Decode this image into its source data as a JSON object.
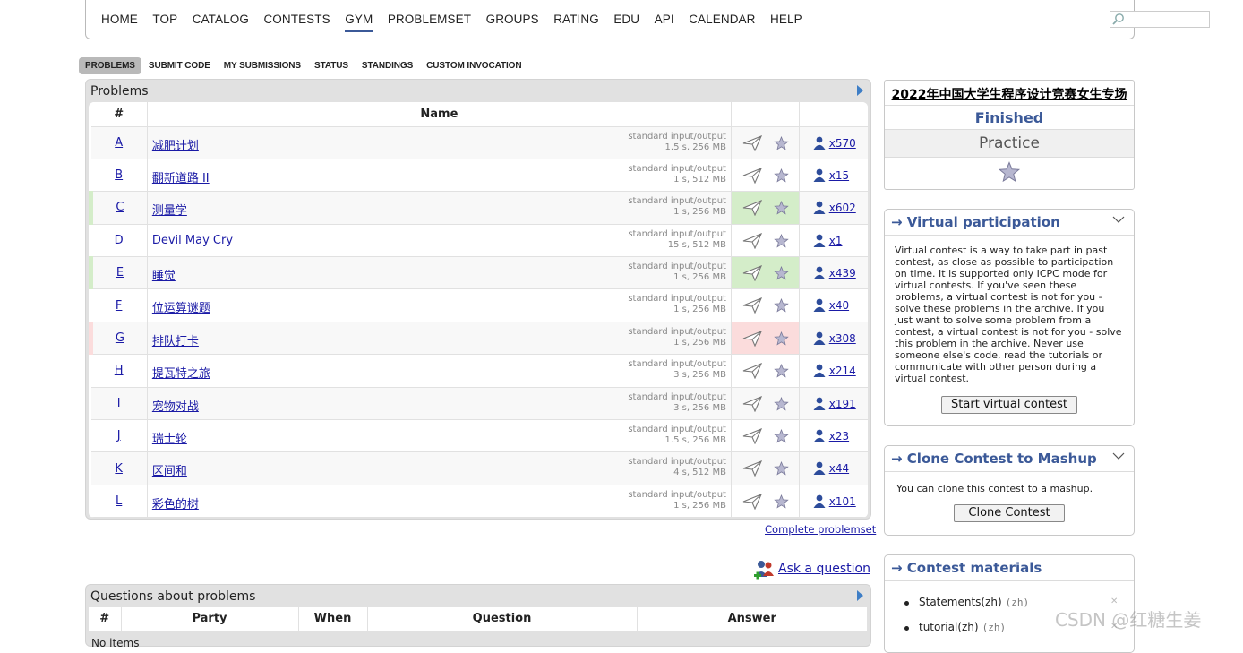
{
  "topnav": {
    "items": [
      "HOME",
      "TOP",
      "CATALOG",
      "CONTESTS",
      "GYM",
      "PROBLEMSET",
      "GROUPS",
      "RATING",
      "EDU",
      "API",
      "CALENDAR",
      "HELP"
    ],
    "active": "GYM"
  },
  "subnav": {
    "items": [
      "PROBLEMS",
      "SUBMIT CODE",
      "MY SUBMISSIONS",
      "STATUS",
      "STANDINGS",
      "CUSTOM INVOCATION"
    ],
    "active": "PROBLEMS"
  },
  "problems": {
    "title": "Problems",
    "headers": {
      "index": "#",
      "name": "Name"
    },
    "rows": [
      {
        "index": "A",
        "name": "减肥计划",
        "io": "standard input/output",
        "limits": "1.5 s, 256 MB",
        "solved": "x570",
        "status": ""
      },
      {
        "index": "B",
        "name": "翻新道路 II",
        "io": "standard input/output",
        "limits": "1 s, 512 MB",
        "solved": "x15",
        "status": ""
      },
      {
        "index": "C",
        "name": "测量学",
        "io": "standard input/output",
        "limits": "1 s, 256 MB",
        "solved": "x602",
        "status": "accepted"
      },
      {
        "index": "D",
        "name": "Devil May Cry",
        "io": "standard input/output",
        "limits": "15 s, 512 MB",
        "solved": "x1",
        "status": ""
      },
      {
        "index": "E",
        "name": "睡觉",
        "io": "standard input/output",
        "limits": "1 s, 256 MB",
        "solved": "x439",
        "status": "accepted"
      },
      {
        "index": "F",
        "name": "位运算谜题",
        "io": "standard input/output",
        "limits": "1 s, 256 MB",
        "solved": "x40",
        "status": ""
      },
      {
        "index": "G",
        "name": "排队打卡",
        "io": "standard input/output",
        "limits": "1 s, 256 MB",
        "solved": "x308",
        "status": "rejected"
      },
      {
        "index": "H",
        "name": "提瓦特之旅",
        "io": "standard input/output",
        "limits": "3 s, 256 MB",
        "solved": "x214",
        "status": ""
      },
      {
        "index": "I",
        "name": "宠物对战",
        "io": "standard input/output",
        "limits": "3 s, 256 MB",
        "solved": "x191",
        "status": ""
      },
      {
        "index": "J",
        "name": "瑞士轮",
        "io": "standard input/output",
        "limits": "1.5 s, 256 MB",
        "solved": "x23",
        "status": ""
      },
      {
        "index": "K",
        "name": "区间和",
        "io": "standard input/output",
        "limits": "4 s, 512 MB",
        "solved": "x44",
        "status": ""
      },
      {
        "index": "L",
        "name": "彩色的树",
        "io": "standard input/output",
        "limits": "1 s, 256 MB",
        "solved": "x101",
        "status": ""
      }
    ],
    "complete_link": "Complete problemset"
  },
  "ask": {
    "label": "Ask a question"
  },
  "questions": {
    "title": "Questions about problems",
    "headers": [
      "#",
      "Party",
      "When",
      "Question",
      "Answer"
    ],
    "empty": "No items"
  },
  "sidebar": {
    "contest_name": "2022年中国大学生程序设计竞赛女生专场",
    "phase": "Finished",
    "type": "Practice",
    "virtual": {
      "title": "→ Virtual participation",
      "text": "Virtual contest is a way to take part in past contest, as close as possible to participation on time. It is supported only ICPC mode for virtual contests. If you've seen these problems, a virtual contest is not for you - solve these problems in the archive. If you just want to solve some problem from a contest, a virtual contest is not for you - solve this problem in the archive. Never use someone else's code, read the tutorials or communicate with other person during a virtual contest.",
      "button": "Start virtual contest"
    },
    "clone": {
      "title": "→ Clone Contest to Mashup",
      "text": "You can clone this contest to a mashup.",
      "button": "Clone Contest"
    },
    "materials": {
      "title": "→ Contest materials",
      "items": [
        {
          "label": "Statements(zh)",
          "lang": "(zh)"
        },
        {
          "label": "tutorial(zh)",
          "lang": "(zh)"
        }
      ]
    }
  },
  "watermark": "CSDN @红糖生姜",
  "colors": {
    "accent": "#3b5998",
    "accepted": "#d4edc9",
    "rejected": "#fbdcdc",
    "link": "#1a1aa6"
  }
}
